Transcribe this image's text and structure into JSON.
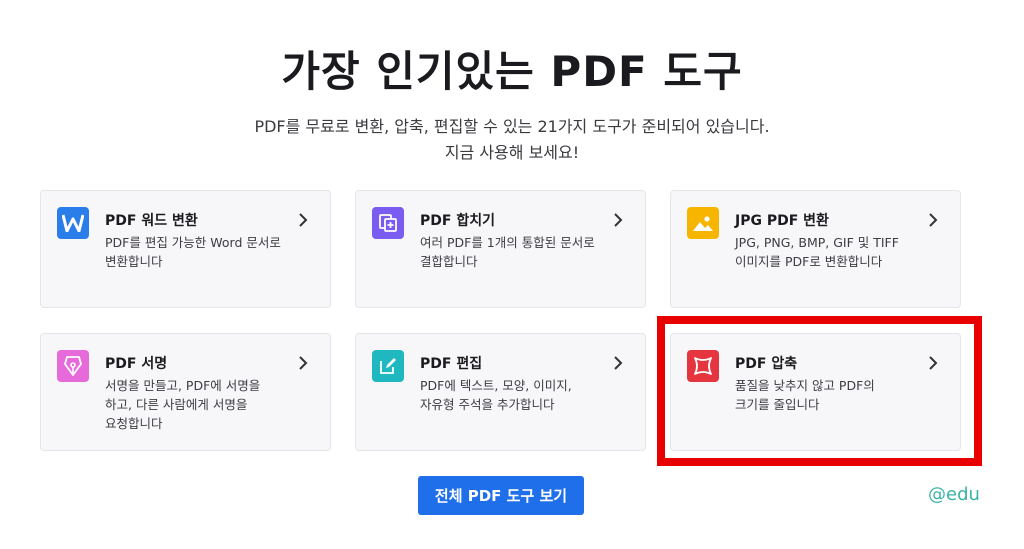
{
  "header": {
    "title": "가장 인기있는 PDF 도구",
    "subtitle_line1": "PDF를 무료로 변환, 압축, 편집할 수 있는 21가지 도구가 준비되어 있습니다.",
    "subtitle_line2": "지금 사용해 보세요!"
  },
  "tools": [
    {
      "title": "PDF 워드 변환",
      "desc": "PDF를 편집 가능한 Word 문서로 변환합니다",
      "icon": "word-icon",
      "color": "#2b7de9"
    },
    {
      "title": "PDF 합치기",
      "desc": "여러 PDF를 1개의 통합된 문서로 결합합니다",
      "icon": "merge-icon",
      "color": "#7b5cf0"
    },
    {
      "title": "JPG PDF 변환",
      "desc": "JPG, PNG, BMP, GIF 및 TIFF 이미지를 PDF로 변환합니다",
      "icon": "image-icon",
      "color": "#f7b500"
    },
    {
      "title": "PDF 서명",
      "desc": "서명을 만들고, PDF에 서명을 하고, 다른 사람에게 서명을 요청합니다",
      "icon": "pen-nib-icon",
      "color": "#e66ad9"
    },
    {
      "title": "PDF 편집",
      "desc": "PDF에 텍스트, 모양, 이미지, 자유형 주석을 추가합니다",
      "icon": "edit-icon",
      "color": "#1fb8c1"
    },
    {
      "title": "PDF 압축",
      "desc": "품질을 낮추지 않고 PDF의 크기를 줄입니다",
      "icon": "compress-icon",
      "color": "#e5353f"
    }
  ],
  "cta": {
    "label": "전체 PDF 도구 보기",
    "color": "#1f6feb"
  },
  "watermark": "@edu",
  "highlight_color": "#e80000"
}
